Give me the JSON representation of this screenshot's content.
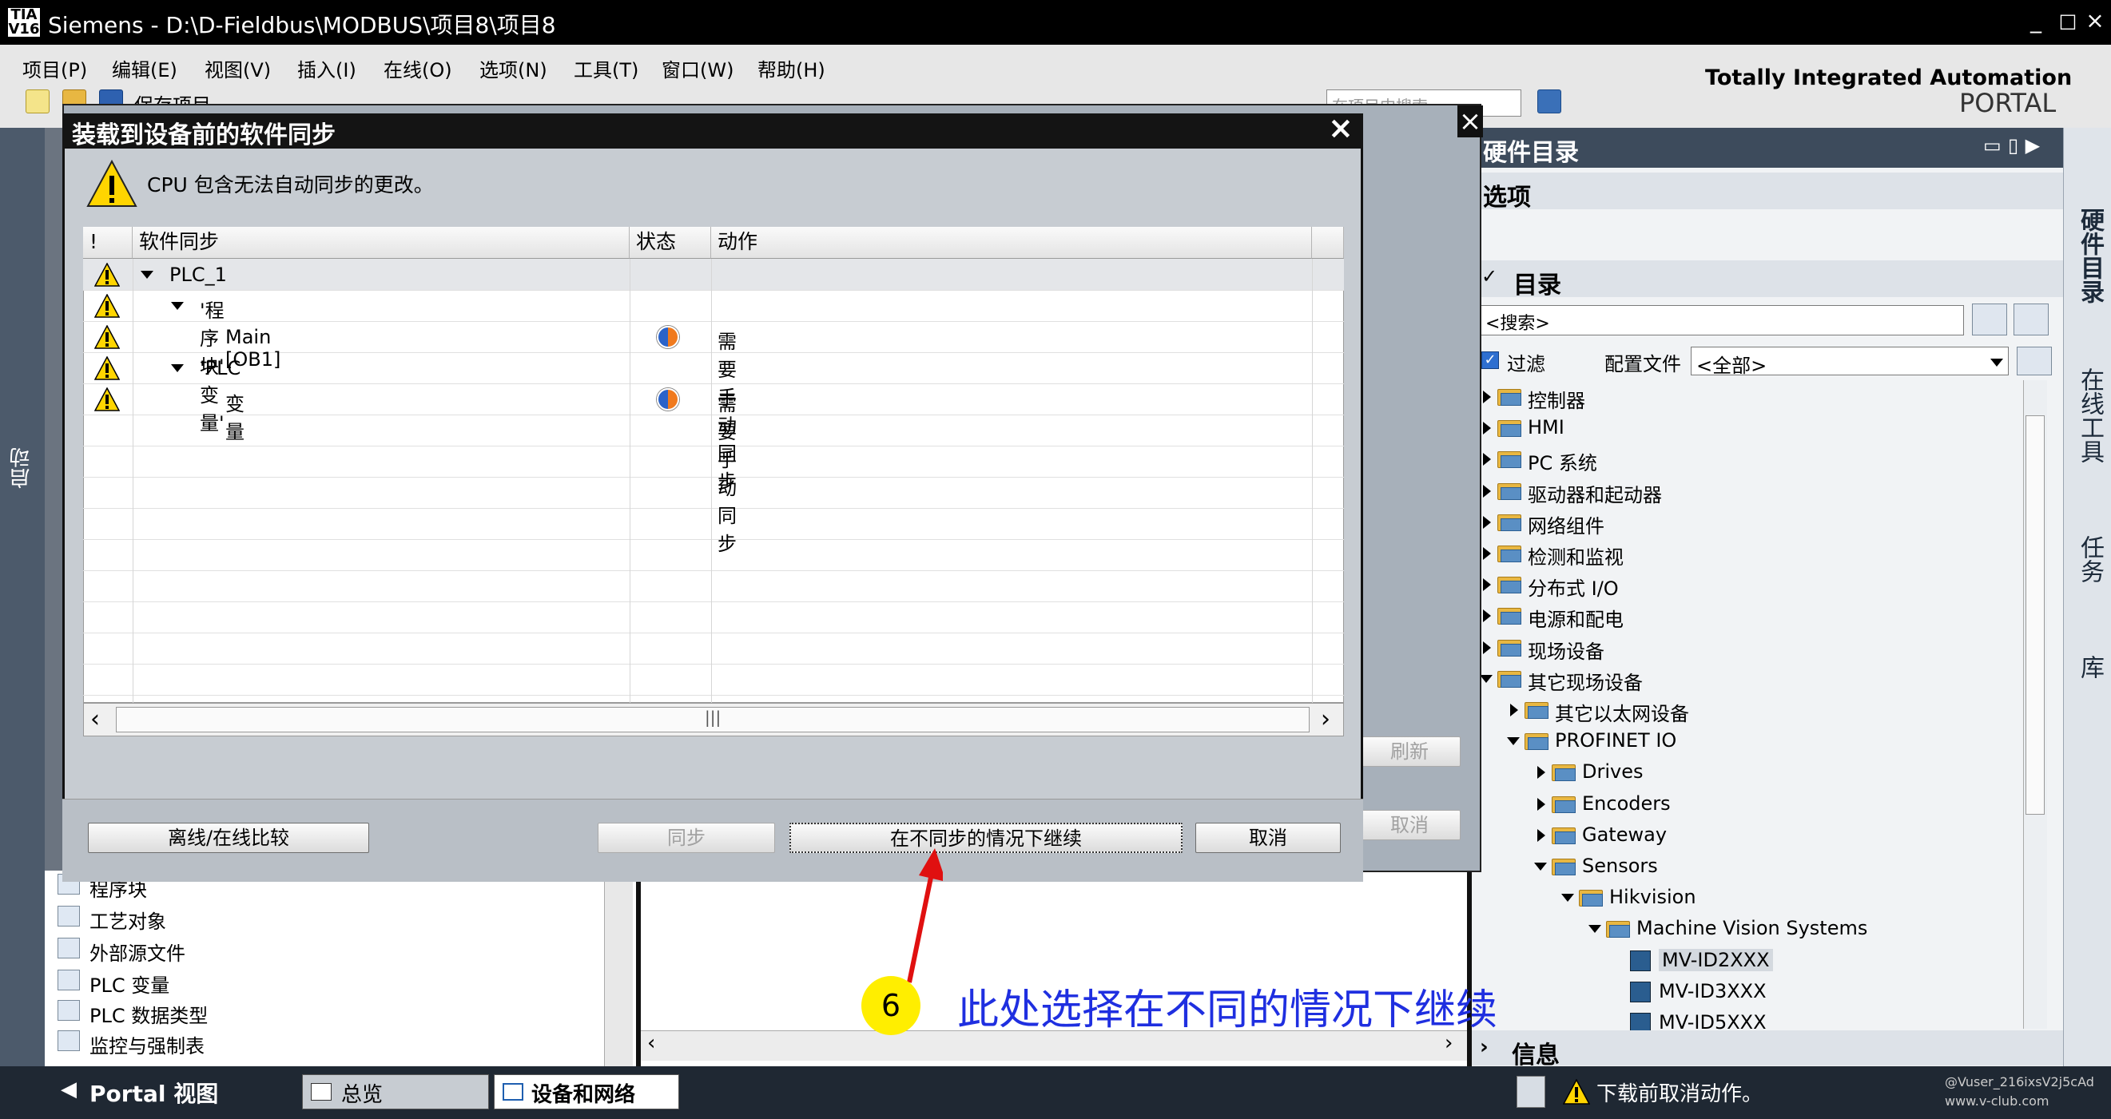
{
  "window": {
    "title": "Siemens  -  D:\\D-Fieldbus\\MODBUS\\项目8\\项目8",
    "min": "_",
    "max": "□",
    "close": "×"
  },
  "brand": {
    "line1": "Totally Integrated Automation",
    "line2": "PORTAL"
  },
  "menu": [
    "项目(P)",
    "编辑(E)",
    "视图(V)",
    "插入(I)",
    "在线(O)",
    "选项(N)",
    "工具(T)",
    "窗口(W)",
    "帮助(H)"
  ],
  "toolbar": {
    "save_label": "保存项目",
    "search_placeholder": "在项目中搜索"
  },
  "left_strip": {
    "label": "启动"
  },
  "dialog": {
    "title": "装载到设备前的软件同步",
    "close": "×",
    "message": "CPU 包含无法自动同步的更改。",
    "columns": [
      "!",
      "软件同步",
      "状态",
      "动作"
    ],
    "rows": [
      {
        "name": "PLC_1",
        "indent": 0,
        "expanded": true,
        "status": false,
        "action": ""
      },
      {
        "name": "'程序块'",
        "indent": 1,
        "expanded": true,
        "status": false,
        "action": ""
      },
      {
        "name": "Main [OB1]",
        "indent": 2,
        "expanded": null,
        "status": true,
        "action": "需要手动同步"
      },
      {
        "name": "'PLC 变量'",
        "indent": 1,
        "expanded": true,
        "status": false,
        "action": ""
      },
      {
        "name": "变量",
        "indent": 2,
        "expanded": null,
        "status": true,
        "action": "需要手动同步"
      }
    ],
    "buttons": {
      "compare": "离线/在线比较",
      "sync": "同步",
      "continue": "在不同步的情况下继续",
      "cancel": "取消"
    }
  },
  "behind_dialog": {
    "refresh": "刷新",
    "cancel": "取消"
  },
  "project_tree": {
    "items": [
      "程序块",
      "工艺对象",
      "外部源文件",
      "PLC 变量",
      "PLC 数据类型",
      "监控与强制表"
    ]
  },
  "catalog": {
    "header": "硬件目录",
    "options": "选项",
    "section": "目录",
    "search_placeholder": "<搜索>",
    "filter_label": "过滤",
    "profile_label": "配置文件",
    "profile_value": "<全部>",
    "items": [
      {
        "label": "控制器",
        "level": 0,
        "state": "collapsed"
      },
      {
        "label": "HMI",
        "level": 0,
        "state": "collapsed"
      },
      {
        "label": "PC 系统",
        "level": 0,
        "state": "collapsed"
      },
      {
        "label": "驱动器和起动器",
        "level": 0,
        "state": "collapsed"
      },
      {
        "label": "网络组件",
        "level": 0,
        "state": "collapsed"
      },
      {
        "label": "检测和监视",
        "level": 0,
        "state": "collapsed"
      },
      {
        "label": "分布式 I/O",
        "level": 0,
        "state": "collapsed"
      },
      {
        "label": "电源和配电",
        "level": 0,
        "state": "collapsed"
      },
      {
        "label": "现场设备",
        "level": 0,
        "state": "collapsed"
      },
      {
        "label": "其它现场设备",
        "level": 0,
        "state": "expanded"
      },
      {
        "label": "其它以太网设备",
        "level": 1,
        "state": "collapsed"
      },
      {
        "label": "PROFINET IO",
        "level": 1,
        "state": "expanded"
      },
      {
        "label": "Drives",
        "level": 2,
        "state": "collapsed"
      },
      {
        "label": "Encoders",
        "level": 2,
        "state": "collapsed"
      },
      {
        "label": "Gateway",
        "level": 2,
        "state": "collapsed"
      },
      {
        "label": "Sensors",
        "level": 2,
        "state": "expanded"
      },
      {
        "label": "Hikvision",
        "level": 3,
        "state": "expanded"
      },
      {
        "label": "Machine Vision Systems",
        "level": 4,
        "state": "expanded"
      },
      {
        "label": "MV-ID2XXX",
        "level": 5,
        "state": "leaf"
      },
      {
        "label": "MV-ID3XXX",
        "level": 5,
        "state": "leaf"
      },
      {
        "label": "MV-ID5XXX",
        "level": 5,
        "state": "leaf"
      }
    ],
    "info": "信息"
  },
  "side_tabs": [
    "硬件目录",
    "在线工具",
    "任务",
    "库"
  ],
  "statusbar": {
    "portal": "Portal 视图",
    "overview": "总览",
    "devices": "设备和网络",
    "message": "下载前取消动作。",
    "watermark1": "@Vuser_216ixsV2j5cAd",
    "watermark2": "www.v-club.com"
  },
  "annotation": {
    "number": "6",
    "text": "此处选择在不同的情况下继续"
  },
  "colors": {
    "accent_blue": "#1f2fe0",
    "annotation_yellow": "#ffee00",
    "arrow_red": "#e01010"
  }
}
